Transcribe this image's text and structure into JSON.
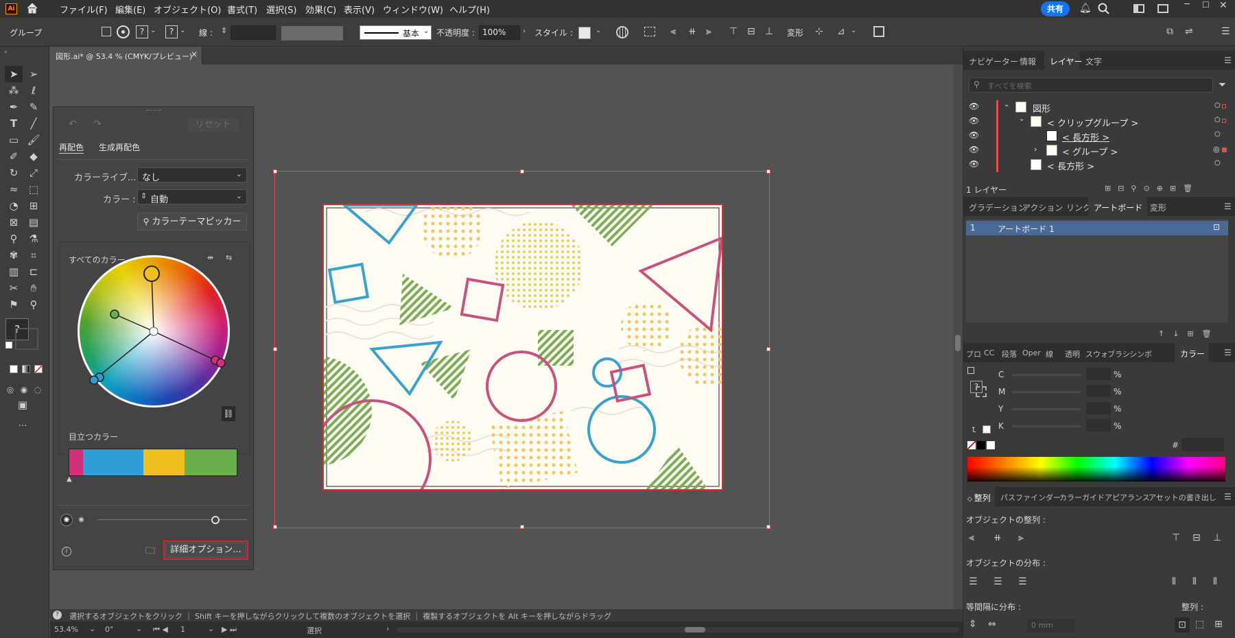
{
  "app": {
    "logo": "Ai",
    "home_icon": "home-icon"
  },
  "menu": [
    "ファイル(F)",
    "編集(E)",
    "オブジェクト(O)",
    "書式(T)",
    "選択(S)",
    "効果(C)",
    "表示(V)",
    "ウィンドウ(W)",
    "ヘルプ(H)"
  ],
  "topright": {
    "share": "共有"
  },
  "control": {
    "group_label": "グループ",
    "stroke_label": "線 :",
    "stroke_style": "基本",
    "opacity_label": "不透明度 :",
    "opacity_value": "100%",
    "style_label": "スタイル :",
    "transform_label": "変形",
    "pick_label": "?"
  },
  "document": {
    "tab_title": "図形.ai* @ 53.4 % (CMYK/プレビュー)",
    "close": "×"
  },
  "recolor": {
    "reset": "リセット",
    "tab_recolor": "再配色",
    "tab_generative": "生成再配色",
    "library_label": "カラーライブ...",
    "library_value": "なし",
    "color_label": "カラー :",
    "color_value": "自動",
    "theme_picker": "カラーテーマピッカー",
    "all_colors": "すべてのカラー",
    "prominent": "目立つカラー",
    "advanced": "詳細オプション...",
    "prominent_colors": [
      "#d2307a",
      "#2e9ed4",
      "#f0c020",
      "#6aae50"
    ]
  },
  "status": {
    "message": "選択するオブジェクトをクリック ｜ Shift キーを押しながらクリックして複数のオブジェクトを選択 ｜ 複製するオブジェクトを Alt キーを押しながらドラッグ",
    "zoom": "53.4%",
    "rotation": "0°",
    "artboard_no": "1",
    "mode": "選択"
  },
  "panels": {
    "top_tabs": [
      "ナビゲーター",
      "情報",
      "レイヤー",
      "文字"
    ],
    "search_placeholder": "すべてを検索",
    "layers": [
      {
        "name": "図形"
      },
      {
        "name": "< クリップグループ >"
      },
      {
        "name": "< 長方形 >"
      },
      {
        "name": "< グループ >"
      },
      {
        "name": "< 長方形 >"
      }
    ],
    "layer_count": "1 レイヤー",
    "mid_tabs": [
      "グラデーション",
      "アクション",
      "リンク",
      "アートボード",
      "変形"
    ],
    "artboard_row": {
      "num": "1",
      "name": "アートボード 1"
    },
    "color_tabs": [
      "プロ",
      "CC",
      "段落",
      "Oper",
      "線",
      "透明",
      "スウォ",
      "ブラシ",
      "シンボ",
      "カラー"
    ],
    "cmyk": [
      {
        "label": "C",
        "unit": "%"
      },
      {
        "label": "M",
        "unit": "%"
      },
      {
        "label": "Y",
        "unit": "%"
      },
      {
        "label": "K",
        "unit": "%"
      }
    ],
    "hash": "#",
    "align_tabs": [
      "整列",
      "パスファインダー",
      "カラーガイド",
      "アピアランス",
      "アセットの書き出し"
    ],
    "align_objects": "オブジェクトの整列 :",
    "distribute_objects": "オブジェクトの分布 :",
    "distribute_spacing": "等間隔に分布 :",
    "align_to": "整列 :",
    "spacing_value": "0 mm"
  }
}
